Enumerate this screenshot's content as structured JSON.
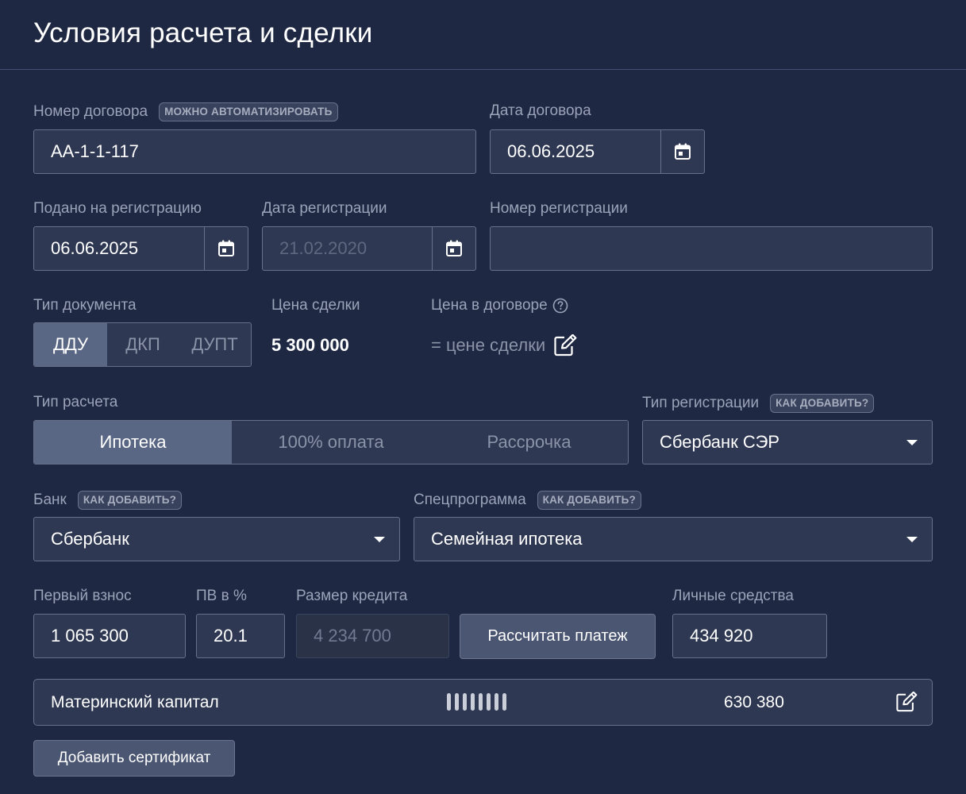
{
  "header": {
    "title": "Условия расчета и сделки"
  },
  "contract_number": {
    "label": "Номер договора",
    "badge": "МОЖНО АВТОМАТИЗИРОВАТЬ",
    "value": "АА-1-1-117"
  },
  "contract_date": {
    "label": "Дата договора",
    "value": "06.06.2025",
    "icon": "calendar-icon"
  },
  "submitted": {
    "label": "Подано на регистрацию",
    "value": "06.06.2025",
    "icon": "calendar-icon"
  },
  "registration_date": {
    "label": "Дата регистрации",
    "placeholder": "21.02.2020",
    "icon": "calendar-icon"
  },
  "registration_number": {
    "label": "Номер регистрации",
    "value": ""
  },
  "doc_type": {
    "label": "Тип документа",
    "options": [
      "ДДУ",
      "ДКП",
      "ДУПТ"
    ],
    "selected": "ДДУ"
  },
  "deal_price": {
    "label": "Цена сделки",
    "value": "5 300 000"
  },
  "contract_price": {
    "label": "Цена в договоре",
    "value": "= цене сделки",
    "help_icon": "question-circle-icon",
    "edit_icon": "edit-icon"
  },
  "payment_type": {
    "label": "Тип расчета",
    "options": [
      "Ипотека",
      "100% оплата",
      "Рассрочка"
    ],
    "selected": "Ипотека"
  },
  "registration_type": {
    "label": "Тип регистрации",
    "badge": "КАК ДОБАВИТЬ?",
    "value": "Сбербанк СЭР"
  },
  "bank": {
    "label": "Банк",
    "badge": "КАК ДОБАВИТЬ?",
    "value": "Сбербанк"
  },
  "special_program": {
    "label": "Спецпрограмма",
    "badge": "КАК ДОБАВИТЬ?",
    "value": "Семейная ипотека"
  },
  "down_payment": {
    "label": "Первый взнос",
    "value": "1 065 300"
  },
  "down_payment_pct": {
    "label": "ПВ в %",
    "value": "20.1"
  },
  "loan_amount": {
    "label": "Размер кредита",
    "value": "4 234 700"
  },
  "calc_button": {
    "label": "Рассчитать платеж"
  },
  "own_funds": {
    "label": "Личные средства",
    "value": "434 920"
  },
  "maternity_capital": {
    "label": "Материнский капитал",
    "masked_digits": 8,
    "amount": "630 380",
    "edit_icon": "edit-icon"
  },
  "add_certificate": {
    "label": "Добавить сертификат"
  },
  "colors": {
    "background": "#1f2843",
    "field": "#2e3852",
    "active_segment": "#5a6784",
    "label": "#9aa3b8"
  }
}
